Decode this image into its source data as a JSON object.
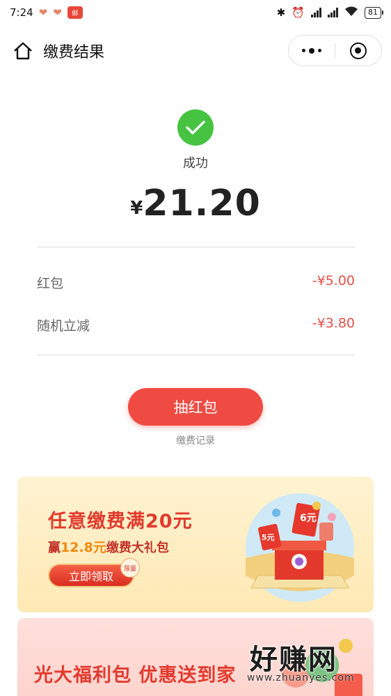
{
  "status_bar": {
    "time": "7:24",
    "app_badge": "邮",
    "battery": "81"
  },
  "nav": {
    "title": "缴费结果"
  },
  "result": {
    "status": "成功",
    "currency": "¥",
    "amount": "21.20"
  },
  "discounts": [
    {
      "label": "红包",
      "value": "-¥5.00"
    },
    {
      "label": "随机立减",
      "value": "-¥3.80"
    }
  ],
  "actions": {
    "draw_button": "抽红包",
    "record_link": "缴费记录"
  },
  "banner1": {
    "title": "任意缴费满20元",
    "sub_prefix": "赢",
    "sub_highlight": "12.8元",
    "sub_suffix": "缴费大礼包",
    "button": "立即领取",
    "tag": "限量",
    "art_labels": [
      "6元",
      "5元"
    ]
  },
  "banner2": {
    "title": "光大福利包 优惠送到家"
  },
  "watermark": {
    "main": "好赚网",
    "url": "www.zhuanyes.com"
  },
  "colors": {
    "success": "#45c341",
    "accent_red": "#ef4b43",
    "discount_red": "#e25349"
  }
}
